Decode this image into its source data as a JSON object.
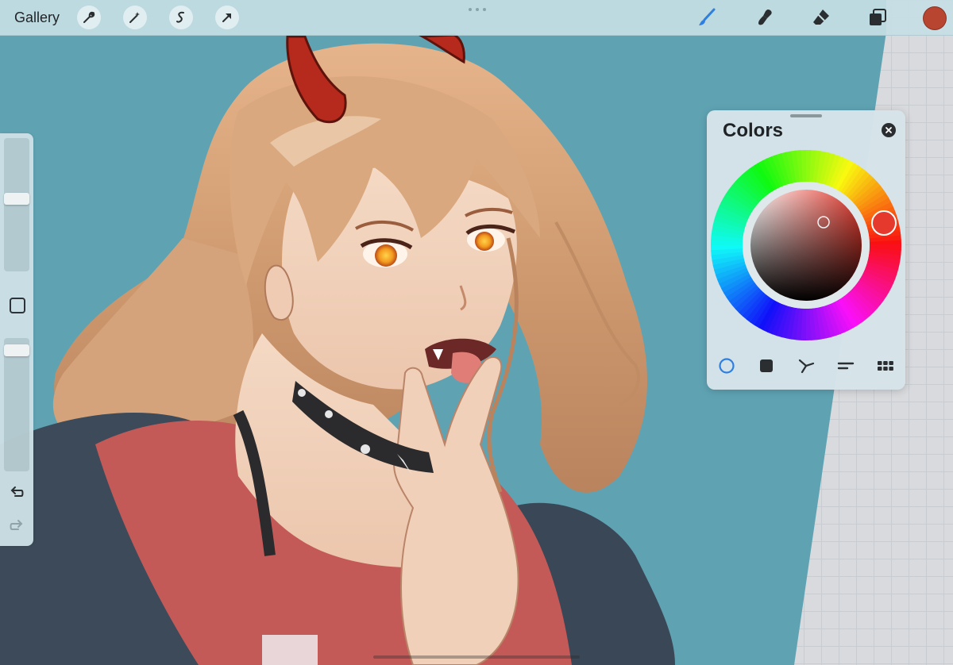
{
  "toolbar": {
    "gallery_label": "Gallery",
    "left_tools": [
      "wrench-icon",
      "magic-wand-icon",
      "selection-icon",
      "transform-arrow-icon"
    ],
    "right_tools": [
      "brush-icon",
      "smudge-icon",
      "eraser-icon",
      "layers-icon"
    ],
    "current_color": "#b8452f"
  },
  "sidebar": {
    "brush_size_level": 0.55,
    "opacity_level": 0.95,
    "tools": [
      "modify-square-icon",
      "undo-icon",
      "redo-icon"
    ]
  },
  "colors_panel": {
    "title": "Colors",
    "selected_hue_color": "#e5392d",
    "tabs": [
      "disc-icon",
      "classic-icon",
      "harmony-icon",
      "value-icon",
      "palettes-icon"
    ],
    "active_tab": "disc-icon"
  },
  "colors": {
    "canvas_bg": "#5fa3b3",
    "toolbar_bg": "#c5dee4",
    "accent_blue": "#2f7fe0"
  }
}
